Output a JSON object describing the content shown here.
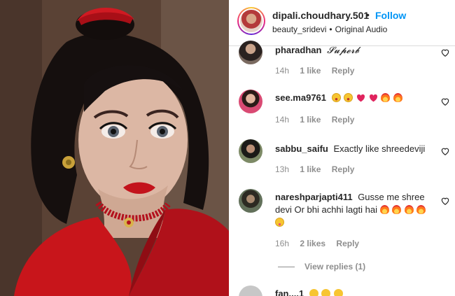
{
  "post": {
    "username": "dipali.choudhary.501",
    "separator": "•",
    "follow_label": "Follow",
    "audio_owner": "beauty_sridevi",
    "audio_sep": "•",
    "audio_label": "Original Audio"
  },
  "comments": [
    {
      "user": "pharadhan",
      "text": "𝓢𝓾𝓹𝓮𝓻𝓫",
      "time": "14h",
      "likes": "1 like",
      "reply": "Reply",
      "emojis": []
    },
    {
      "user": "see.ma9761",
      "text": "",
      "time": "14h",
      "likes": "1 like",
      "reply": "Reply",
      "emojis": [
        "star-eyes",
        "star-eyes",
        "heart",
        "heart",
        "fire",
        "fire"
      ]
    },
    {
      "user": "sabbu_saifu",
      "text": "Exactly like shreedeviji",
      "time": "13h",
      "likes": "1 like",
      "reply": "Reply",
      "emojis": []
    },
    {
      "user": "nareshparjapti411",
      "text": "Gusse me shree devi Or bhi achhi lagti hai",
      "time": "16h",
      "likes": "2 likes",
      "reply": "Reply",
      "emojis": [
        "fire",
        "fire",
        "fire",
        "fire",
        "tongue"
      ],
      "view_replies": "View replies (1)"
    },
    {
      "user": "fan....1",
      "text": "",
      "emojis": [
        "face",
        "face",
        "face"
      ]
    }
  ],
  "colors": {
    "accent": "#0095f6",
    "muted": "#8e8e8e",
    "heart": "#ed4956",
    "dress": "#c8151b"
  }
}
